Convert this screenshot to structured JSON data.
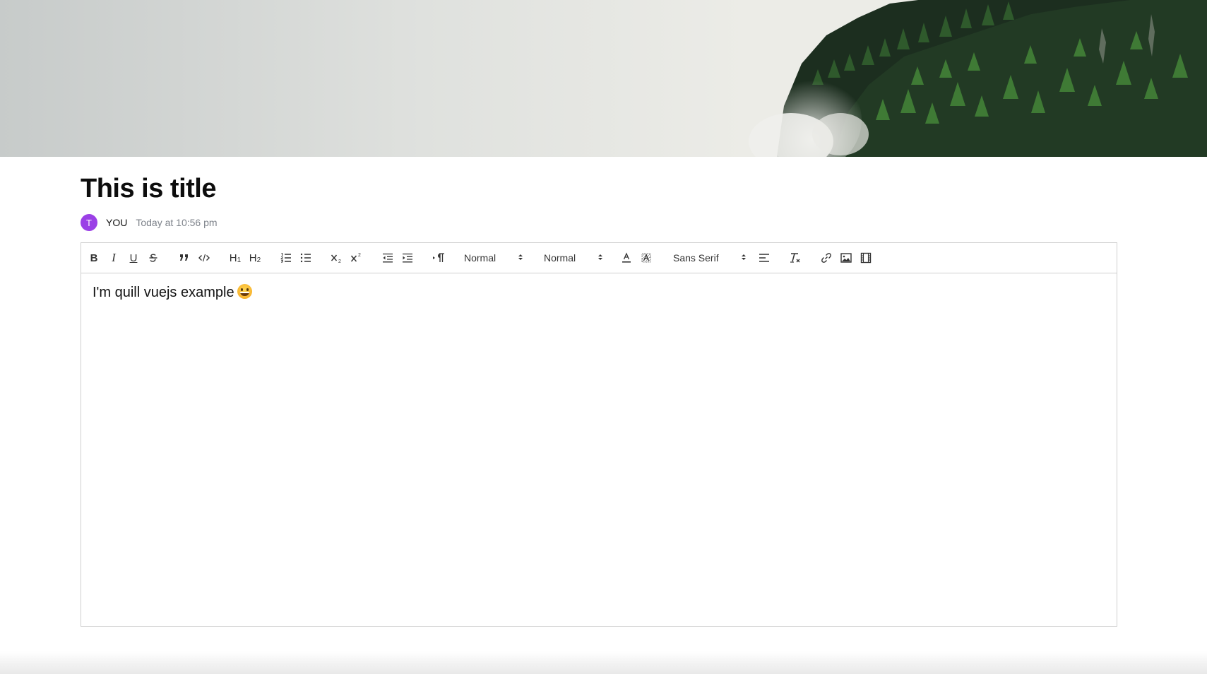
{
  "cover": {
    "icon": "cover-image-mountain-forest"
  },
  "page": {
    "title": "This is title",
    "author_initial": "T",
    "author_name": "YOU",
    "timestamp": "Today at 10:56 pm",
    "avatar_color": "#9b40e6"
  },
  "toolbar": {
    "bold": "B",
    "italic": "I",
    "underline": "U",
    "h1": "H",
    "h1_sub": "1",
    "h2": "H",
    "h2_sub": "2",
    "size_picker": "Normal",
    "header_picker": "Normal",
    "font_picker": "Sans Serif"
  },
  "editor": {
    "content": "I'm quill vuejs example",
    "emoji": "grinning-face-emoji"
  }
}
